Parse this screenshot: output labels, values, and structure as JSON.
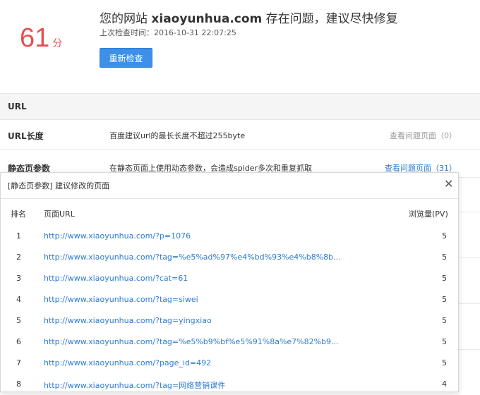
{
  "header": {
    "score": "61",
    "score_unit": "分",
    "title_prefix": "您的网站 ",
    "title_site": "xiaoyunhua.com",
    "title_suffix": " 存在问题，建议尽快修复",
    "last_check": "上次检查时间：2016-10-31 22:07:25",
    "recheck_label": "重新检查"
  },
  "section": {
    "title": "URL",
    "rows": [
      {
        "name": "URL长度",
        "desc": "百度建议url的最长长度不超过255byte",
        "link": "查看问题页面（0）"
      },
      {
        "name": "静态页参数",
        "desc": "在静态页面上使用动态参数，会造成spider多次和重复抓取",
        "link": "查看问题页面（31）"
      }
    ]
  },
  "modal": {
    "title": "[静态页参数] 建议修改的页面",
    "close": "✕",
    "headers": {
      "rank": "排名",
      "url": "页面URL",
      "pv": "浏览量(PV)"
    },
    "rows": [
      {
        "rank": "1",
        "url": "http://www.xiaoyunhua.com/?p=1076",
        "pv": "5"
      },
      {
        "rank": "2",
        "url": "http://www.xiaoyunhua.com/?tag=%e5%ad%97%e4%bd%93%e4%b8%8b...",
        "pv": "5"
      },
      {
        "rank": "3",
        "url": "http://www.xiaoyunhua.com/?cat=61",
        "pv": "5"
      },
      {
        "rank": "4",
        "url": "http://www.xiaoyunhua.com/?tag=siwei",
        "pv": "5"
      },
      {
        "rank": "5",
        "url": "http://www.xiaoyunhua.com/?tag=yingxiao",
        "pv": "5"
      },
      {
        "rank": "6",
        "url": "http://www.xiaoyunhua.com/?tag=%e5%b9%bf%e5%91%8a%e7%82%b9...",
        "pv": "5"
      },
      {
        "rank": "7",
        "url": "http://www.xiaoyunhua.com/?page_id=492",
        "pv": "5"
      },
      {
        "rank": "8",
        "url": "http://www.xiaoyunhua.com/?tag=网络营销课件",
        "pv": "4"
      }
    ]
  }
}
